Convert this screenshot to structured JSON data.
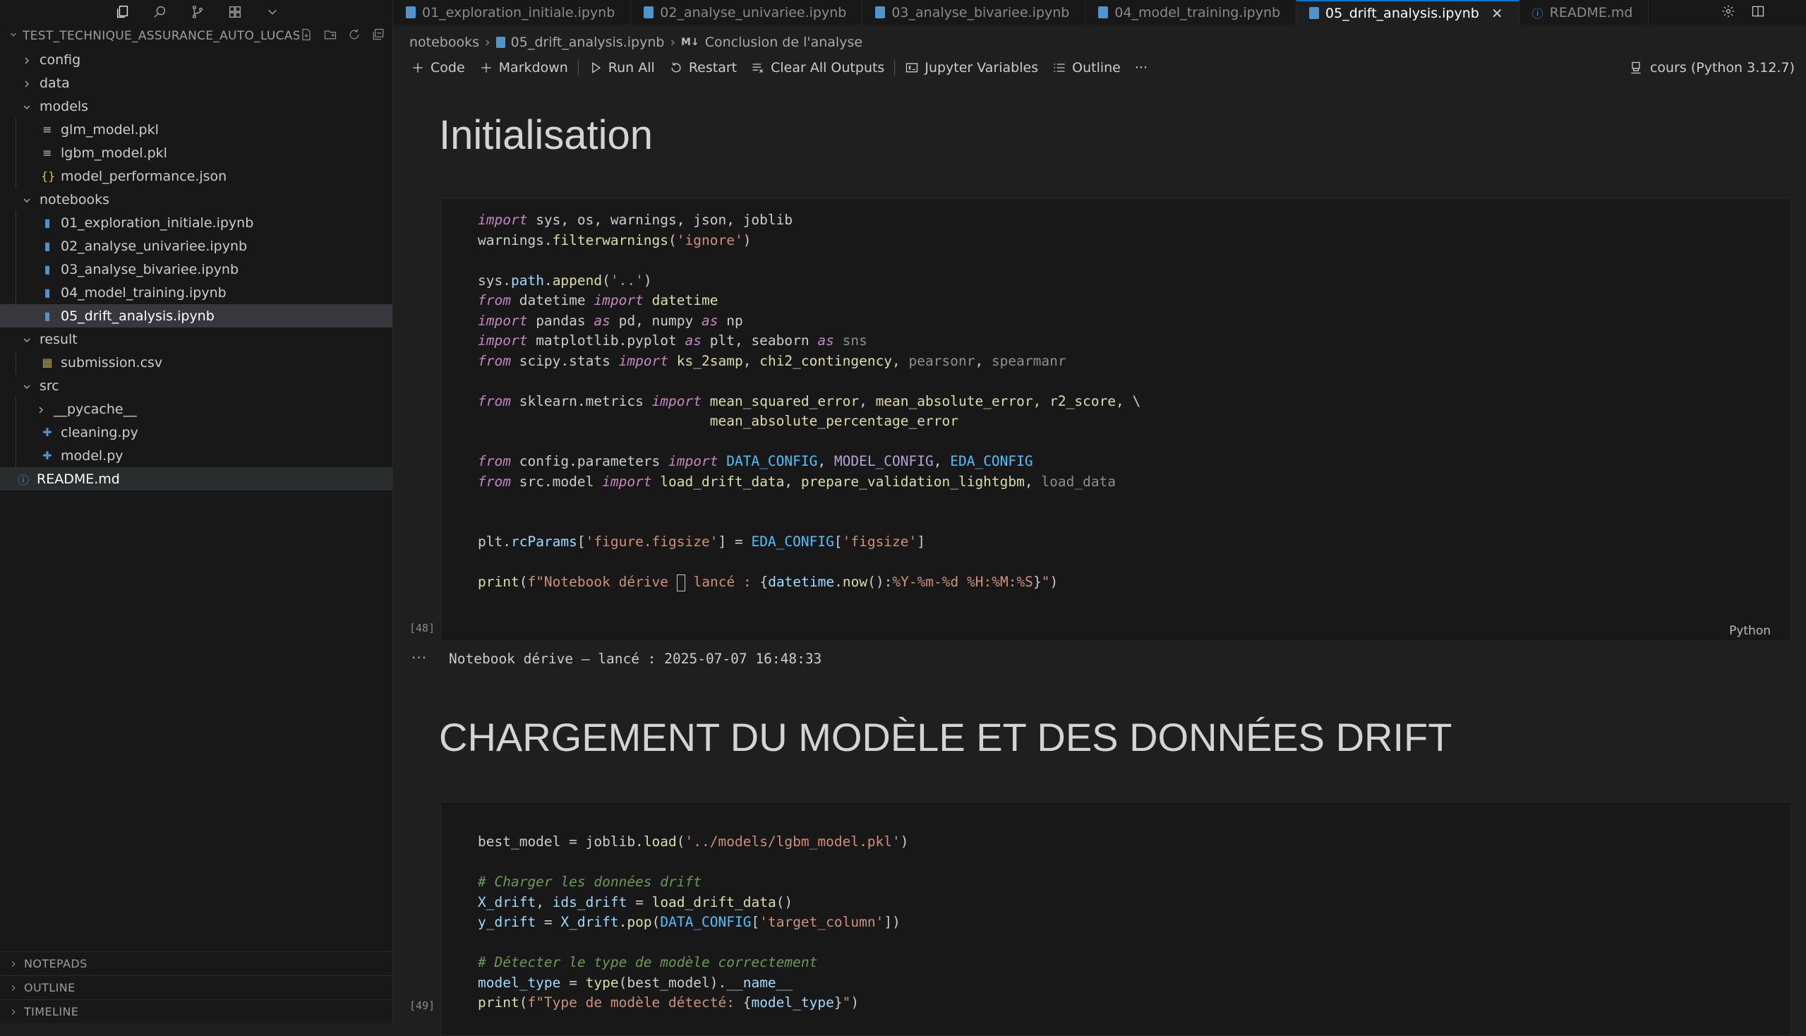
{
  "sidebar": {
    "explorer_title": "TEST_TECHNIQUE_ASSURANCE_AUTO_LUCAS...",
    "tree": [
      {
        "label": "config",
        "kind": "folder",
        "depth": 0,
        "expanded": false
      },
      {
        "label": "data",
        "kind": "folder",
        "depth": 0,
        "expanded": false
      },
      {
        "label": "models",
        "kind": "folder",
        "depth": 0,
        "expanded": true
      },
      {
        "label": "glm_model.pkl",
        "kind": "file",
        "icon": "lines",
        "depth": 1
      },
      {
        "label": "lgbm_model.pkl",
        "kind": "file",
        "icon": "lines",
        "depth": 1
      },
      {
        "label": "model_performance.json",
        "kind": "file",
        "icon": "json",
        "depth": 1
      },
      {
        "label": "notebooks",
        "kind": "folder",
        "depth": 0,
        "expanded": true
      },
      {
        "label": "01_exploration_initiale.ipynb",
        "kind": "file",
        "icon": "notebook",
        "depth": 1
      },
      {
        "label": "02_analyse_univariee.ipynb",
        "kind": "file",
        "icon": "notebook",
        "depth": 1
      },
      {
        "label": "03_analyse_bivariee.ipynb",
        "kind": "file",
        "icon": "notebook",
        "depth": 1
      },
      {
        "label": "04_model_training.ipynb",
        "kind": "file",
        "icon": "notebook",
        "depth": 1
      },
      {
        "label": "05_drift_analysis.ipynb",
        "kind": "file",
        "icon": "notebook",
        "depth": 1,
        "selected": true
      },
      {
        "label": "result",
        "kind": "folder",
        "depth": 0,
        "expanded": true
      },
      {
        "label": "submission.csv",
        "kind": "file",
        "icon": "table",
        "depth": 1
      },
      {
        "label": "src",
        "kind": "folder",
        "depth": 0,
        "expanded": true
      },
      {
        "label": "__pycache__",
        "kind": "folder",
        "depth": 1,
        "expanded": false
      },
      {
        "label": "cleaning.py",
        "kind": "file",
        "icon": "python",
        "depth": 1
      },
      {
        "label": "model.py",
        "kind": "file",
        "icon": "python",
        "depth": 1
      },
      {
        "label": "README.md",
        "kind": "file",
        "icon": "info",
        "depth": 0,
        "highlight": true
      }
    ],
    "panels": [
      "NOTEPADS",
      "OUTLINE",
      "TIMELINE"
    ]
  },
  "tabs": [
    {
      "label": "01_exploration_initiale.ipynb",
      "icon": "notebook",
      "active": false
    },
    {
      "label": "02_analyse_univariee.ipynb",
      "icon": "notebook",
      "active": false
    },
    {
      "label": "03_analyse_bivariee.ipynb",
      "icon": "notebook",
      "active": false
    },
    {
      "label": "04_model_training.ipynb",
      "icon": "notebook",
      "active": false
    },
    {
      "label": "05_drift_analysis.ipynb",
      "icon": "notebook",
      "active": true
    },
    {
      "label": "README.md",
      "icon": "info",
      "active": false
    }
  ],
  "breadcrumb": {
    "part1": "notebooks",
    "part2": "05_drift_analysis.ipynb",
    "md_badge": "M↓",
    "part3": "Conclusion de l'analyse"
  },
  "toolbar": {
    "code": "Code",
    "markdown": "Markdown",
    "run_all": "Run All",
    "restart": "Restart",
    "clear_outputs": "Clear All Outputs",
    "variables": "Jupyter Variables",
    "outline": "Outline",
    "more": "···",
    "kernel": "cours (Python 3.12.7)"
  },
  "notebook": {
    "heading1": "Initialisation",
    "cell1_exec": "[48]",
    "cell1_lang": "Python",
    "cell1_output": "Notebook dérive – lancé : 2025-07-07 16:48:33",
    "output_dots": "···",
    "heading2": "CHARGEMENT DU MODÈLE ET DES DONNÉES DRIFT",
    "cell2_exec": "[49]"
  },
  "colors": {
    "accent": "#0078d4",
    "keyword": "#c586c0",
    "function": "#dcdcaa",
    "string": "#ce9178",
    "comment": "#6a9955",
    "variable": "#9cdcfe",
    "constant": "#4fc1ff"
  }
}
